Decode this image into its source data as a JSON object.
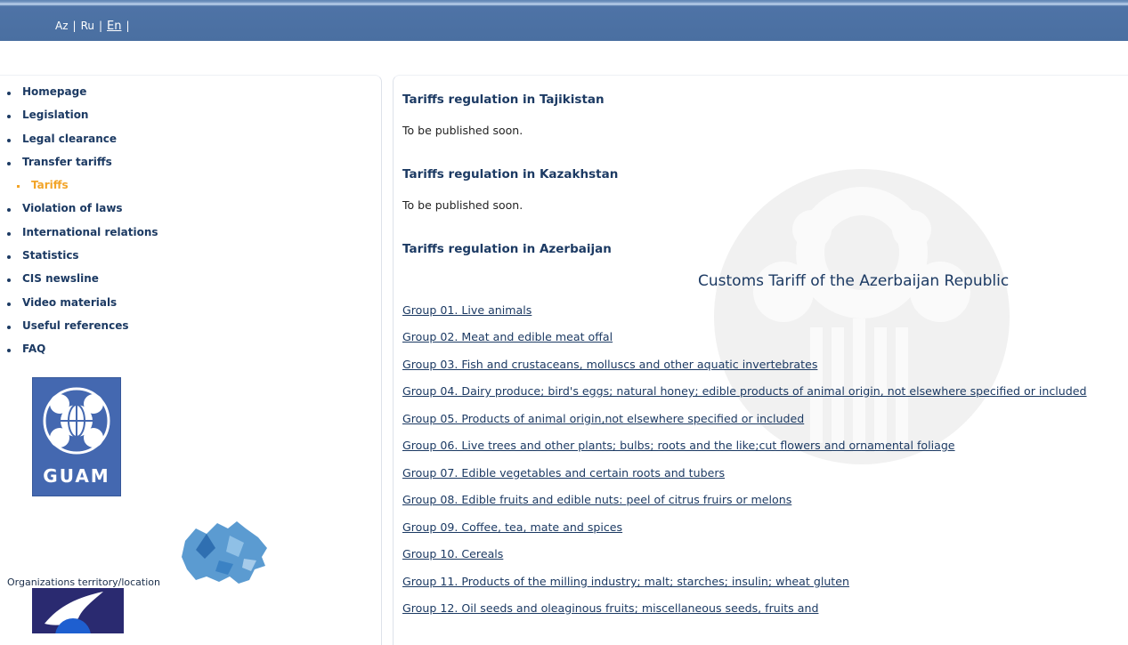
{
  "languages": [
    {
      "label": "Az",
      "active": false
    },
    {
      "label": "Ru",
      "active": false
    },
    {
      "label": "En",
      "active": true
    }
  ],
  "separator": "|",
  "nav": [
    {
      "label": "Homepage"
    },
    {
      "label": "Legislation"
    },
    {
      "label": "Legal clearance"
    },
    {
      "label": "Transfer tariffs"
    },
    {
      "label": "Tariffs",
      "sub": true
    },
    {
      "label": "Violation of laws"
    },
    {
      "label": "International relations"
    },
    {
      "label": "Statistics"
    },
    {
      "label": "CIS newsline"
    },
    {
      "label": "Video materials"
    },
    {
      "label": "Useful references"
    },
    {
      "label": "FAQ"
    }
  ],
  "logo_text": "GUAM",
  "org_caption": "Organizations territory/location",
  "sections": [
    {
      "heading": "Tariffs regulation in Tajikistan",
      "text": "To be published soon."
    },
    {
      "heading": "Tariffs regulation in Kazakhstan",
      "text": "To be published soon."
    },
    {
      "heading": "Tariffs regulation in Azerbaijan"
    }
  ],
  "tariff_title": "Customs Tariff of the Azerbaijan Republic",
  "groups": [
    "Group 01. Live animals",
    "Group 02. Meat and edible meat offal",
    "Group 03. Fish and crustaceans, molluscs and other aquatic invertebrates",
    "Group 04. Dairy produce; bird's eggs; natural honey; edible products of animal origin, not elsewhere specified or included",
    "Group 05. Products of animal origin,not elsewhere specified or included",
    "Group 06. Live trees and other plants; bulbs; roots and the like;cut flowers and ornamental foliage",
    "Group 07. Edible vegetables and certain roots and tubers",
    "Group 08. Edible fruits and edible nuts: peel of citrus fruirs or melons",
    "Group 09. Coffee, tea, mate and spices",
    "Group 10. Cereals",
    "Group 11. Products of the milling industry; malt; starches; insulin; wheat gluten",
    "Group 12. Oil seeds and oleaginous fruits; miscellaneous seeds, fruits and"
  ],
  "colors": {
    "header": "#4a6fa1",
    "nav_text": "#1c3a63",
    "nav_active": "#f2a428"
  }
}
